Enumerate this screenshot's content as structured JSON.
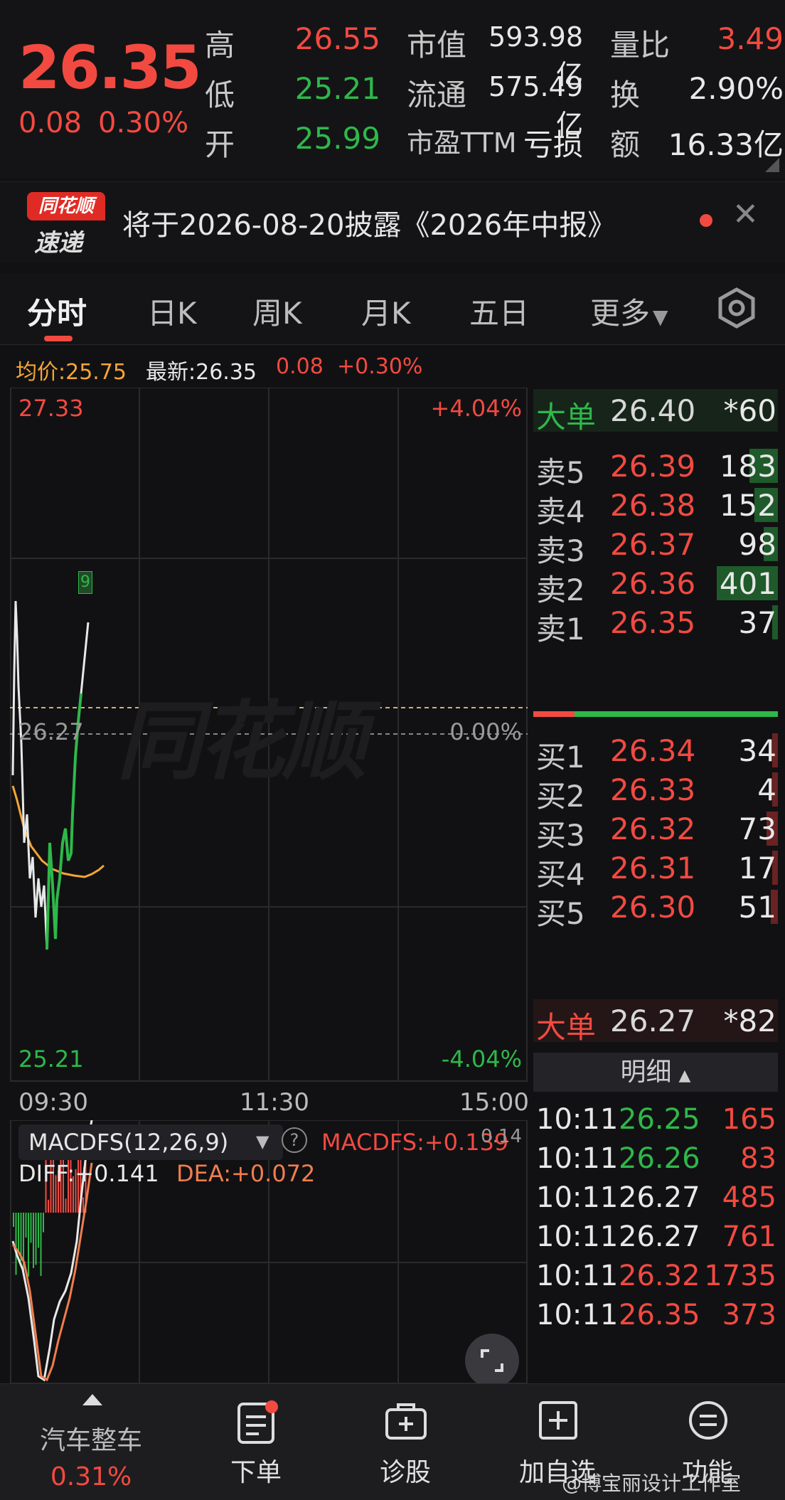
{
  "quote": {
    "price": "26.35",
    "change": "0.08",
    "change_pct": "0.30%",
    "rows": [
      {
        "l1": "高",
        "v1": "26.55",
        "l2": "市值",
        "v2": "593.98亿",
        "l3": "量比",
        "v3": "3.49"
      },
      {
        "l1": "低",
        "v1": "25.21",
        "l2": "流通",
        "v2": "575.49亿",
        "l3": "换",
        "v3": "2.90%"
      },
      {
        "l1": "开",
        "v1": "25.99",
        "l2": "市盈TTM",
        "v2": "亏损",
        "l3": "额",
        "v3": "16.33亿"
      }
    ]
  },
  "notice": {
    "logo_top": "同花顺",
    "logo_bottom": "速递",
    "text": "将于2026-08-20披露《2026年中报》"
  },
  "tabs": [
    "分时",
    "日K",
    "周K",
    "月K",
    "五日",
    "更多"
  ],
  "infobar": {
    "avg": "均价:25.75",
    "latest": "最新:26.35",
    "chg": "0.08",
    "pct": "+0.30%"
  },
  "chart": {
    "y_top": "27.33",
    "y_mid": "26.27",
    "y_bot": "25.21",
    "pct_top": "+4.04%",
    "pct_mid": "0.00%",
    "pct_bot": "-4.04%",
    "times": [
      "09:30",
      "11:30",
      "15:00"
    ],
    "marker": "9",
    "watermark": "同花顺"
  },
  "macd": {
    "title": "MACDFS(12,26,9)",
    "help": "?",
    "value": "MACDFS:+0.139",
    "corner": "0.14",
    "diff": "DIFF:+0.141",
    "dea": "DEA:+0.072"
  },
  "orderbook": {
    "big_top": {
      "label": "大单",
      "price": "26.40",
      "vol": "*60"
    },
    "asks": [
      {
        "label": "卖5",
        "price": "26.39",
        "vol": "183",
        "bar": 0.12
      },
      {
        "label": "卖4",
        "price": "26.38",
        "vol": "152",
        "bar": 0.1
      },
      {
        "label": "卖3",
        "price": "26.37",
        "vol": "98",
        "bar": 0.06
      },
      {
        "label": "卖2",
        "price": "26.36",
        "vol": "401",
        "bar": 0.26
      },
      {
        "label": "卖1",
        "price": "26.35",
        "vol": "37",
        "bar": 0.02
      }
    ],
    "bids": [
      {
        "label": "买1",
        "price": "26.34",
        "vol": "34",
        "bar": 0.02
      },
      {
        "label": "买2",
        "price": "26.33",
        "vol": "4",
        "bar": 0.005
      },
      {
        "label": "买3",
        "price": "26.32",
        "vol": "73",
        "bar": 0.05
      },
      {
        "label": "买4",
        "price": "26.31",
        "vol": "17",
        "bar": 0.01
      },
      {
        "label": "买5",
        "price": "26.30",
        "vol": "51",
        "bar": 0.03
      }
    ],
    "big_bottom": {
      "label": "大单",
      "price": "26.27",
      "vol": "*82"
    },
    "detail_header": "明细",
    "trades": [
      {
        "time": "10:11",
        "price": "26.25",
        "vol": "165",
        "pc": "green"
      },
      {
        "time": "10:11",
        "price": "26.26",
        "vol": "83",
        "pc": "green"
      },
      {
        "time": "10:11",
        "price": "26.27",
        "vol": "485",
        "pc": "white"
      },
      {
        "time": "10:11",
        "price": "26.27",
        "vol": "761",
        "pc": "white"
      },
      {
        "time": "10:11",
        "price": "26.32",
        "vol": "1735",
        "pc": "red"
      },
      {
        "time": "10:11",
        "price": "26.35",
        "vol": "373",
        "pc": "red"
      }
    ]
  },
  "bottom": {
    "sector": "汽车整车",
    "sector_pct": "0.31%",
    "items": [
      "下单",
      "诊股",
      "加自选",
      "功能"
    ],
    "watermark": "@博宝丽设计工作室"
  },
  "colors": {
    "up": "#f24a41",
    "down": "#2eb84a",
    "avg": "#f3a634",
    "bg": "#111113"
  }
}
